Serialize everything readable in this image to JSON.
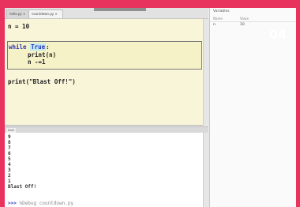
{
  "tabs": [
    {
      "label": "hello.py ×"
    },
    {
      "label": "countdown.py ×"
    }
  ],
  "editor": {
    "line1": "n = 10",
    "while_kw": "while",
    "true_kw": "True",
    "colon": ":",
    "line_print_n": "print(n)",
    "line_decrement": "n -=1",
    "line_blast": "print(\"Blast Off!\")"
  },
  "variables": {
    "title": "Variables",
    "col_name": "Name",
    "col_value": "Value",
    "rows": [
      {
        "name": "n",
        "value": "10"
      }
    ]
  },
  "shell": {
    "tab_label": "Shell",
    "output": [
      "9",
      "8",
      "7",
      "6",
      "5",
      "4",
      "3",
      "2",
      "1",
      "Blast Off!"
    ],
    "prompt": ">>>",
    "command": "%Debug countdown.py"
  },
  "badge": "04",
  "colors": {
    "background": "#e8335e",
    "editor": "#f8f5d8",
    "keyword": "#2d36b8"
  }
}
